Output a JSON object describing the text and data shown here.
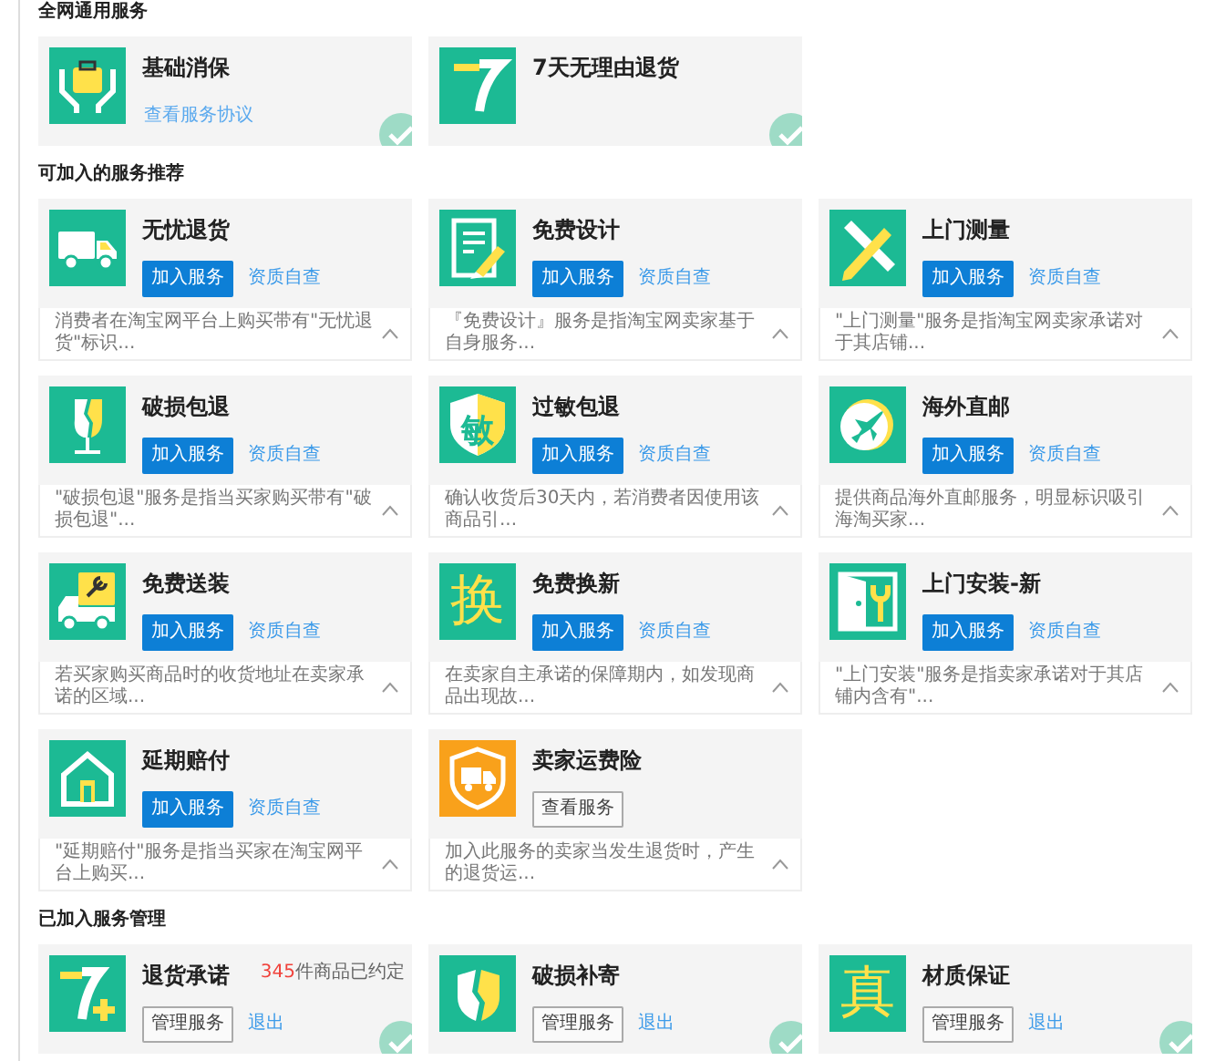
{
  "sections": [
    {
      "title": "全网通用服务",
      "services": [
        {
          "name": "基础消保",
          "kind": "bag",
          "actions": [
            {
              "label": "查看服务协议",
              "kind": "small-link"
            }
          ],
          "checked": true
        },
        {
          "name": "7天无理由退货",
          "kind": "seven",
          "checked": true
        }
      ]
    },
    {
      "title": "可加入的服务推荐",
      "services": [
        {
          "name": "无忧退货",
          "kind": "truck",
          "actions": [
            {
              "label": "加入服务",
              "kind": "primary"
            },
            {
              "label": "资质自查",
              "kind": "link"
            }
          ],
          "description": "消费者在淘宝网平台上购买带有\"无忧退货\"标识...",
          "checked": false
        },
        {
          "name": "免费设计",
          "kind": "design",
          "actions": [
            {
              "label": "加入服务",
              "kind": "primary"
            },
            {
              "label": "资质自查",
              "kind": "link"
            }
          ],
          "description": "『免费设计』服务是指淘宝网卖家基于自身服务...",
          "checked": false
        },
        {
          "name": "上门测量",
          "kind": "ruler",
          "actions": [
            {
              "label": "加入服务",
              "kind": "primary"
            },
            {
              "label": "资质自查",
              "kind": "link"
            }
          ],
          "description": "\"上门测量\"服务是指淘宝网卖家承诺对于其店铺...",
          "checked": false
        },
        {
          "name": "破损包退",
          "kind": "glass",
          "actions": [
            {
              "label": "加入服务",
              "kind": "primary"
            },
            {
              "label": "资质自查",
              "kind": "link"
            }
          ],
          "description": "\"破损包退\"服务是指当买家购买带有\"破损包退\"...",
          "checked": false
        },
        {
          "name": "过敏包退",
          "kind": "shieldglyph",
          "icon_text": "敏",
          "actions": [
            {
              "label": "加入服务",
              "kind": "primary"
            },
            {
              "label": "资质自查",
              "kind": "link"
            }
          ],
          "description": "确认收货后30天内，若消费者因使用该商品引...",
          "checked": false
        },
        {
          "name": "海外直邮",
          "kind": "plane",
          "actions": [
            {
              "label": "加入服务",
              "kind": "primary"
            },
            {
              "label": "资质自查",
              "kind": "link"
            }
          ],
          "description": "提供商品海外直邮服务，明显标识吸引海淘买家...",
          "checked": false
        },
        {
          "name": "免费送装",
          "kind": "toolbox",
          "actions": [
            {
              "label": "加入服务",
              "kind": "primary"
            },
            {
              "label": "资质自查",
              "kind": "link"
            }
          ],
          "description": "若买家购买商品时的收货地址在卖家承诺的区域...",
          "checked": false
        },
        {
          "name": "免费换新",
          "kind": "glyph",
          "icon_text": "换",
          "actions": [
            {
              "label": "加入服务",
              "kind": "primary"
            },
            {
              "label": "资质自查",
              "kind": "link"
            }
          ],
          "description": "在卖家自主承诺的保障期内，如发现商品出现故...",
          "checked": false
        },
        {
          "name": "上门安装-新",
          "kind": "door",
          "actions": [
            {
              "label": "加入服务",
              "kind": "primary"
            },
            {
              "label": "资质自查",
              "kind": "link"
            }
          ],
          "description": "\"上门安装\"服务是指卖家承诺对于其店铺内含有\"...",
          "checked": false
        },
        {
          "name": "延期赔付",
          "kind": "house",
          "actions": [
            {
              "label": "加入服务",
              "kind": "primary"
            },
            {
              "label": "资质自查",
              "kind": "link"
            }
          ],
          "description": "\"延期赔付\"服务是指当买家在淘宝网平台上购买...",
          "checked": false
        },
        {
          "name": "卖家运费险",
          "kind": "insurance",
          "actions": [
            {
              "label": "查看服务",
              "kind": "outline"
            }
          ],
          "description": "加入此服务的卖家当发生退货时，产生的退货运...",
          "checked": false
        }
      ]
    },
    {
      "title": "已加入服务管理",
      "services": [
        {
          "name": "退货承诺",
          "kind": "sevenplus",
          "count": "345",
          "count_suffix": "件商品已约定",
          "actions": [
            {
              "label": "管理服务",
              "kind": "outline"
            },
            {
              "label": "退出",
              "kind": "link"
            }
          ],
          "checked": true
        },
        {
          "name": "破损补寄",
          "kind": "crack",
          "actions": [
            {
              "label": "管理服务",
              "kind": "outline"
            },
            {
              "label": "退出",
              "kind": "link"
            }
          ],
          "checked": true
        },
        {
          "name": "材质保证",
          "kind": "glyph",
          "icon_text": "真",
          "actions": [
            {
              "label": "管理服务",
              "kind": "outline"
            },
            {
              "label": "退出",
              "kind": "link"
            }
          ],
          "checked": true
        }
      ]
    }
  ]
}
